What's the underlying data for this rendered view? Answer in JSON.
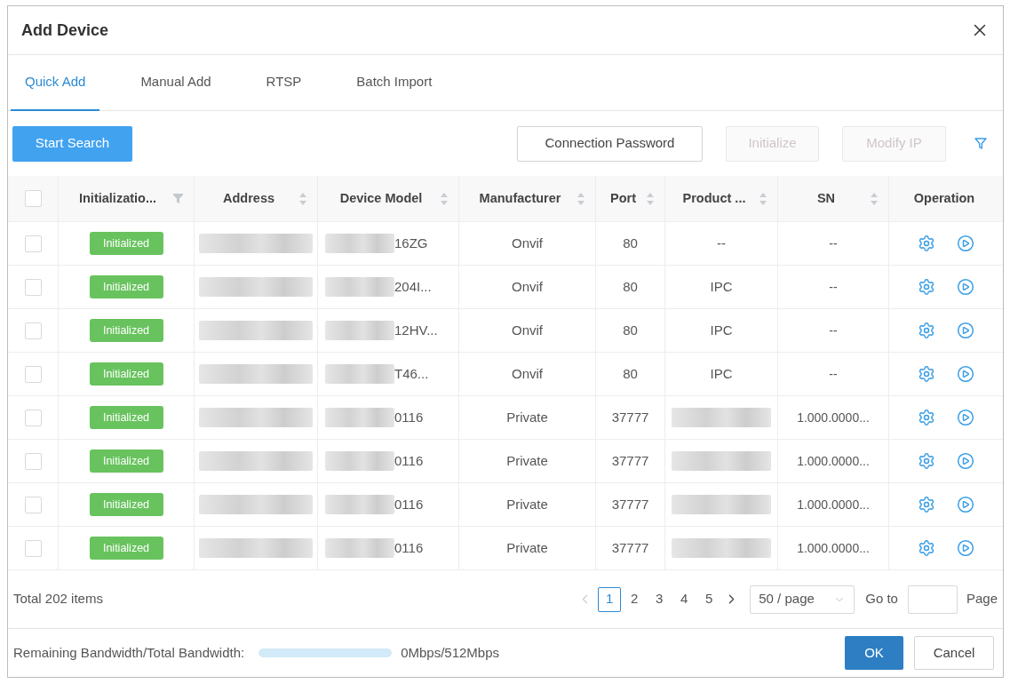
{
  "dialog": {
    "title": "Add Device"
  },
  "tabs": [
    {
      "label": "Quick Add",
      "selected": true
    },
    {
      "label": "Manual Add",
      "selected": false
    },
    {
      "label": "RTSP",
      "selected": false
    },
    {
      "label": "Batch Import",
      "selected": false
    }
  ],
  "toolbar": {
    "buttons": [
      {
        "label": "Start Search",
        "kind": "primary",
        "disabled": false
      },
      {
        "label": "Connection Password",
        "kind": "default",
        "disabled": false
      },
      {
        "label": "Initialize",
        "kind": "default",
        "disabled": true
      },
      {
        "label": "Modify IP",
        "kind": "default",
        "disabled": true
      }
    ]
  },
  "table": {
    "select_all": {
      "checked": false
    },
    "columns": [
      {
        "label": "Initializatio...",
        "kind": "filter"
      },
      {
        "label": "Address",
        "kind": "sort"
      },
      {
        "label": "Device Model",
        "kind": "sort"
      },
      {
        "label": "Manufacturer",
        "kind": "sort"
      },
      {
        "label": "Port",
        "kind": "sort"
      },
      {
        "label": "Product ...",
        "kind": "sort"
      },
      {
        "label": "SN",
        "kind": "sort"
      },
      {
        "label": "Operation",
        "kind": "plain"
      }
    ],
    "rows": [
      {
        "checked": false,
        "status": "Initialized",
        "address": {
          "redacted": true
        },
        "device_model": {
          "text": "16ZG",
          "redacted": true
        },
        "manufacturer": "Onvif",
        "port": "80",
        "product": {
          "text": "--",
          "redacted": false
        },
        "sn": "--"
      },
      {
        "checked": false,
        "status": "Initialized",
        "address": {
          "redacted": true
        },
        "device_model": {
          "text": "204I...",
          "redacted": true
        },
        "manufacturer": "Onvif",
        "port": "80",
        "product": {
          "text": "IPC",
          "redacted": false
        },
        "sn": "--"
      },
      {
        "checked": false,
        "status": "Initialized",
        "address": {
          "redacted": true
        },
        "device_model": {
          "text": "12HV...",
          "redacted": true
        },
        "manufacturer": "Onvif",
        "port": "80",
        "product": {
          "text": "IPC",
          "redacted": false
        },
        "sn": "--"
      },
      {
        "checked": false,
        "status": "Initialized",
        "address": {
          "redacted": true
        },
        "device_model": {
          "text": "T46...",
          "redacted": true
        },
        "manufacturer": "Onvif",
        "port": "80",
        "product": {
          "text": "IPC",
          "redacted": false
        },
        "sn": "--"
      },
      {
        "checked": false,
        "status": "Initialized",
        "address": {
          "redacted": true
        },
        "device_model": {
          "text": "0116",
          "redacted": true
        },
        "manufacturer": "Private",
        "port": "37777",
        "product": {
          "redacted": true
        },
        "sn": "1.000.0000..."
      },
      {
        "checked": false,
        "status": "Initialized",
        "address": {
          "redacted": true
        },
        "device_model": {
          "text": "0116",
          "redacted": true
        },
        "manufacturer": "Private",
        "port": "37777",
        "product": {
          "redacted": true
        },
        "sn": "1.000.0000..."
      },
      {
        "checked": false,
        "status": "Initialized",
        "address": {
          "redacted": true
        },
        "device_model": {
          "text": "0116",
          "redacted": true
        },
        "manufacturer": "Private",
        "port": "37777",
        "product": {
          "redacted": true
        },
        "sn": "1.000.0000..."
      },
      {
        "checked": false,
        "status": "Initialized",
        "address": {
          "redacted": true
        },
        "device_model": {
          "text": "0116",
          "redacted": true
        },
        "manufacturer": "Private",
        "port": "37777",
        "product": {
          "redacted": true
        },
        "sn": "1.000.0000..."
      }
    ]
  },
  "pagination": {
    "total": "Total 202 items",
    "prev_disabled": true,
    "next_disabled": false,
    "pages": [
      {
        "label": "1",
        "selected": true
      },
      {
        "label": "2",
        "selected": false
      },
      {
        "label": "3",
        "selected": false
      },
      {
        "label": "4",
        "selected": false
      },
      {
        "label": "5",
        "selected": false
      }
    ],
    "page_size": "50 / page",
    "goto_label": "Go to",
    "goto_suffix": "Page"
  },
  "footer": {
    "bandwidth_label": "Remaining Bandwidth/Total Bandwidth:",
    "bandwidth": {
      "level": 1,
      "reading": "0Mbps/512Mbps"
    },
    "buttons": [
      {
        "label": "OK",
        "kind": "primary"
      },
      {
        "label": "Cancel",
        "kind": "default"
      }
    ]
  }
}
